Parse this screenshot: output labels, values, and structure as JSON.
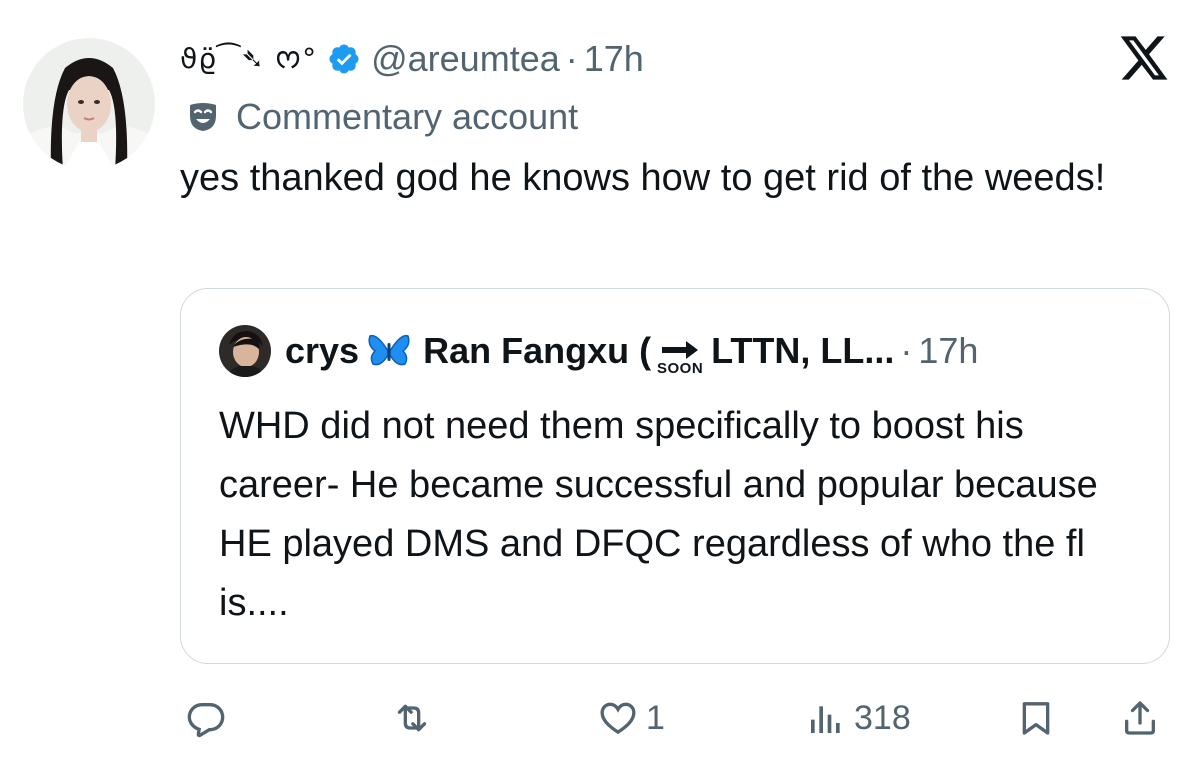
{
  "tweet": {
    "display_name": "ϑϱ̈⁀➴ ᰔ°",
    "handle": "@areumtea",
    "separator": "·",
    "time": "17h",
    "label": "Commentary account",
    "text": "yes thanked god he knows how to get rid of the weeds!"
  },
  "quote": {
    "name_prefix": "crys",
    "name_suffix": "Ran Fangxu (",
    "badge_text": "SOON",
    "name_tail": "LTTN, LL...",
    "separator": "·",
    "time": "17h",
    "text": "WHD did not need them specifically to boost his career- He became successful and popular because HE played DMS and  DFQC regardless of who the fl is...."
  },
  "actions": {
    "reply_count": "",
    "retweet_count": "",
    "like_count": "1",
    "views_count": "318"
  },
  "colors": {
    "verified": "#1d9bf0",
    "secondary_text": "#536471",
    "border": "#cfd9de",
    "butterfly": "#1f8ef1"
  }
}
